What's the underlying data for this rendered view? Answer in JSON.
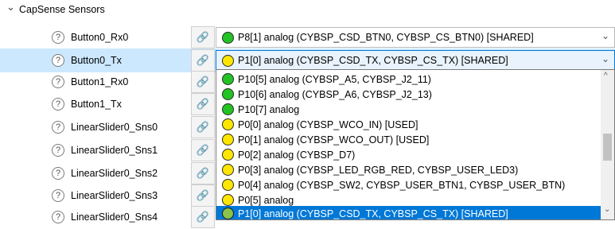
{
  "group": {
    "label": "CapSense Sensors",
    "expand_glyph": "⌄"
  },
  "icons": {
    "help": "?",
    "link": "🔗",
    "chevron": "⌄"
  },
  "colors": {
    "green": "#22c322",
    "yellow": "#ffe600",
    "selection": "#0078d7",
    "row_highlight": "#cce8ff"
  },
  "rows": [
    {
      "label": "Button0_Rx0",
      "value": "P8[1] analog (CYBSP_CSD_BTN0, CYBSP_CS_BTN0) [SHARED]",
      "status": "green"
    },
    {
      "label": "Button0_Tx",
      "value": "P1[0] analog (CYBSP_CSD_TX, CYBSP_CS_TX) [SHARED]",
      "status": "yellow"
    },
    {
      "label": "Button1_Rx0"
    },
    {
      "label": "Button1_Tx"
    },
    {
      "label": "LinearSlider0_Sns0"
    },
    {
      "label": "LinearSlider0_Sns1"
    },
    {
      "label": "LinearSlider0_Sns2"
    },
    {
      "label": "LinearSlider0_Sns3"
    },
    {
      "label": "LinearSlider0_Sns4"
    }
  ],
  "dropdown": {
    "options": [
      {
        "text": "P10[5] analog (CYBSP_A5, CYBSP_J2_11)",
        "status": "green"
      },
      {
        "text": "P10[6] analog (CYBSP_A6, CYBSP_J2_13)",
        "status": "green"
      },
      {
        "text": "P10[7] analog",
        "status": "green"
      },
      {
        "text": "P0[0] analog (CYBSP_WCO_IN) [USED]",
        "status": "yellow"
      },
      {
        "text": "P0[1] analog (CYBSP_WCO_OUT) [USED]",
        "status": "yellow"
      },
      {
        "text": "P0[2] analog (CYBSP_D7)",
        "status": "yellow"
      },
      {
        "text": "P0[3] analog (CYBSP_LED_RGB_RED, CYBSP_USER_LED3)",
        "status": "yellow"
      },
      {
        "text": "P0[4] analog (CYBSP_SW2, CYBSP_USER_BTN1, CYBSP_USER_BTN)",
        "status": "yellow"
      },
      {
        "text": "P0[5] analog",
        "status": "yellow"
      },
      {
        "text": "P1[0] analog (CYBSP_CSD_TX, CYBSP_CS_TX) [SHARED]",
        "status": "yellow-selected"
      }
    ],
    "scroll_up_glyph": "^",
    "scroll_down_glyph": "⌄"
  }
}
